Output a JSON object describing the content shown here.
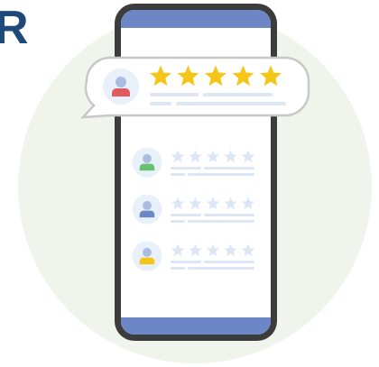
{
  "logo": {
    "letter": "R",
    "color": "#1d4a79"
  },
  "colors": {
    "background_circle": "#eff4ec",
    "phone_frame": "#3c3c3c",
    "phone_screen": "#ffffff",
    "phone_bars": "#6d87c6",
    "bubble_border": "#c8c8c8",
    "star_active": "#f5c518",
    "star_inactive": "#dce6f5",
    "line_color": "#dce6f5",
    "avatar_bg": "#e8f0fa"
  },
  "featured_review": {
    "avatar_icon": "user-icon",
    "avatar_color": "#e25a61",
    "rating": 5,
    "max_rating": 5
  },
  "reviews": [
    {
      "avatar_icon": "user-icon",
      "avatar_color": "#66c271",
      "rating": 0,
      "max_rating": 5
    },
    {
      "avatar_icon": "user-icon",
      "avatar_color": "#6d87c6",
      "rating": 0,
      "max_rating": 5
    },
    {
      "avatar_icon": "user-icon",
      "avatar_color": "#f5c518",
      "rating": 0,
      "max_rating": 5
    }
  ]
}
